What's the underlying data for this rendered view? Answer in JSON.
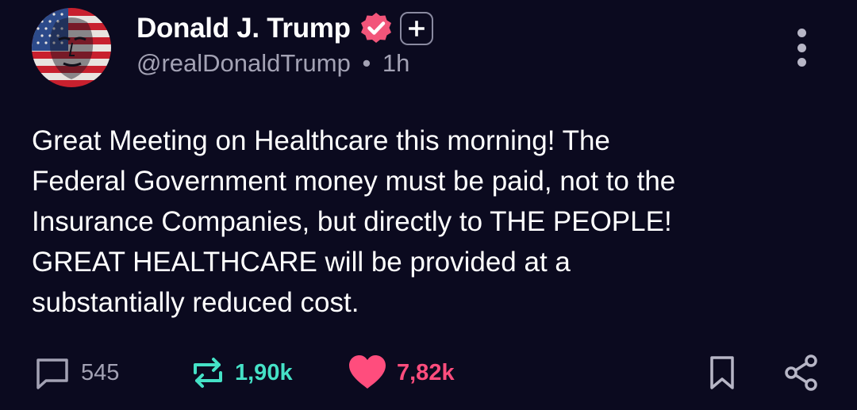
{
  "post": {
    "author": {
      "display_name": "Donald J. Trump",
      "handle": "@realDonaldTrump",
      "separator": "•",
      "time_ago": "1h",
      "verified": true,
      "verified_color": "#f2557a"
    },
    "text": "Great Meeting on Healthcare this morning! The\nFederal Government money must be paid, not to the\nInsurance Companies, but directly to THE PEOPLE!\nGREAT HEALTHCARE will be provided at a\nsubstantially reduced cost.",
    "actions": {
      "replies": "545",
      "reposts": "1,90k",
      "likes": "7,82k"
    },
    "icons": {
      "reply": "comment-icon",
      "repost": "repost-icon",
      "like": "heart-icon",
      "bookmark": "bookmark-icon",
      "share": "share-icon",
      "more": "more-vertical-icon",
      "plus": "plus-icon",
      "verified": "verified-badge-icon"
    },
    "colors": {
      "background": "#0b0a1f",
      "muted_text": "#a3a2b4",
      "repost_accent": "#45e1c6",
      "like_accent": "#ff4d7d"
    }
  }
}
